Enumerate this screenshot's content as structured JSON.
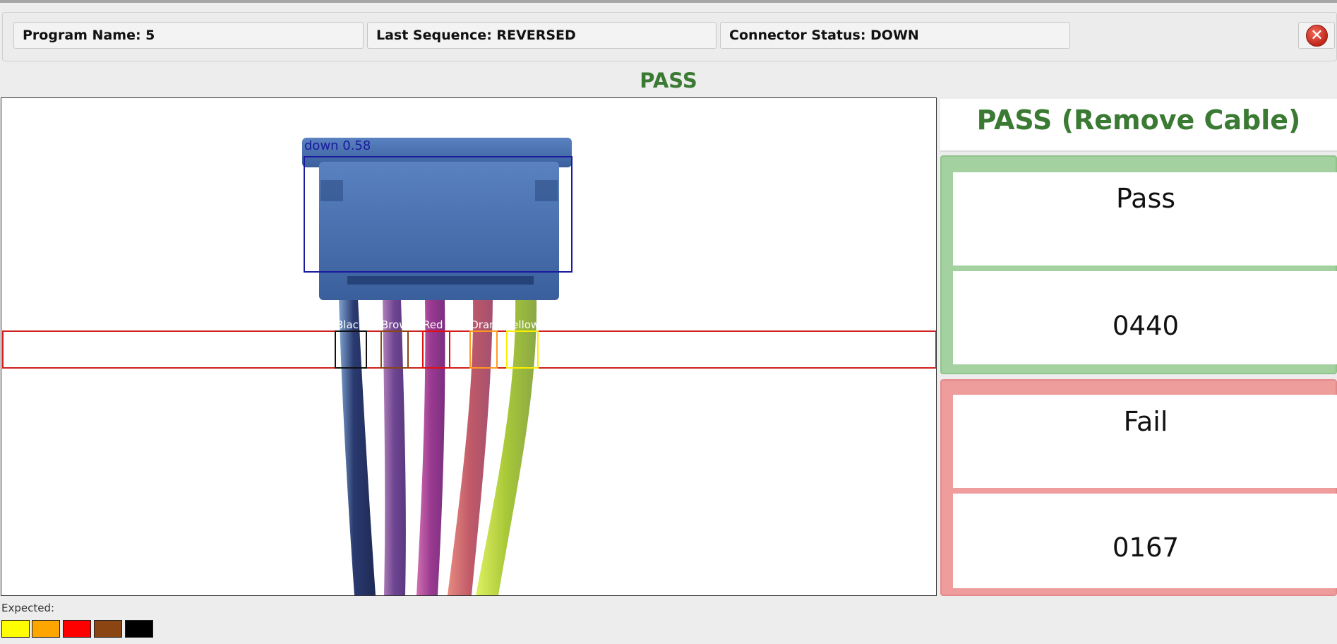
{
  "header": {
    "program_name": "Program Name: 5",
    "last_sequence": "Last Sequence: REVERSED",
    "connector_status": "Connector Status: DOWN",
    "close_icon": "close-icon"
  },
  "overall_status": "PASS",
  "camera_view": {
    "connector_detection_label": "down 0.58",
    "wire_labels": [
      "Black",
      "Brown",
      "Red",
      "Orange",
      "Yellow"
    ]
  },
  "result_panel": {
    "title": "PASS (Remove Cable)",
    "pass": {
      "label": "Pass",
      "count": "0440"
    },
    "fail": {
      "label": "Fail",
      "count": "0167"
    }
  },
  "expected": {
    "label": "Expected:",
    "colors": [
      "#ffff00",
      "#ffa500",
      "#ff0000",
      "#8b4513",
      "#000000"
    ]
  },
  "colors": {
    "pass_green": "#3a7a33",
    "pass_panel": "#a3d1a0",
    "fail_panel": "#ef9c9c",
    "detection_box": "#1a1a9e",
    "roi_line": "#d02020"
  }
}
